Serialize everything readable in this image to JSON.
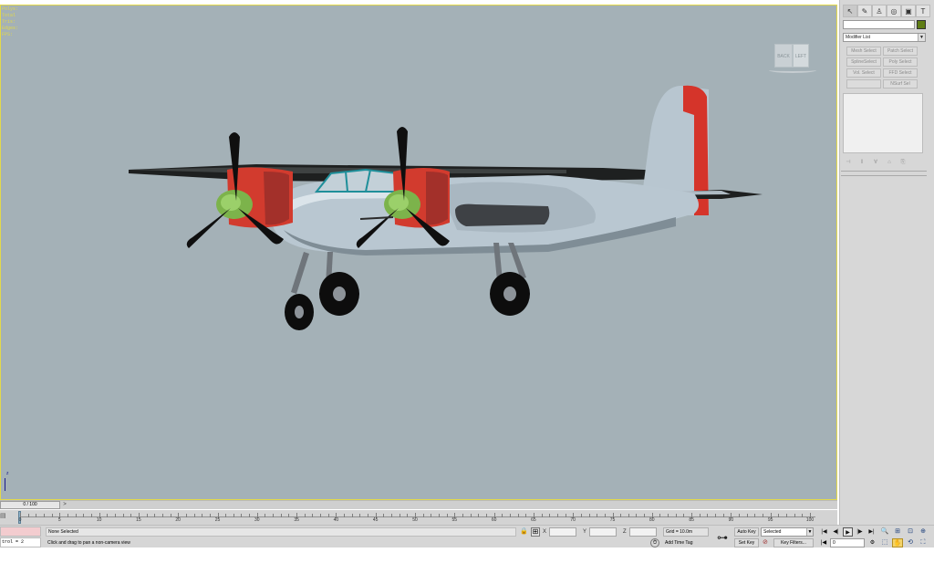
{
  "viewport": {
    "stats": [
      "Polys:",
      "Total    ",
      "Tris:  ",
      "Edges:",
      "",
      "FPS:   "
    ],
    "viewcube": {
      "left_face": "BACK",
      "right_face": "LEFT"
    },
    "axis_label": "z",
    "colors": {
      "background": "#a4b1b7",
      "border": "#e3d94a"
    }
  },
  "command_panel": {
    "tabs": [
      {
        "name": "pointer-icon",
        "glyph": "↖"
      },
      {
        "name": "create-icon",
        "glyph": "✎"
      },
      {
        "name": "hierarchy-icon",
        "glyph": "♙"
      },
      {
        "name": "motion-icon",
        "glyph": "◎"
      },
      {
        "name": "display-icon",
        "glyph": "▣"
      },
      {
        "name": "utilities-icon",
        "glyph": "T"
      }
    ],
    "swatch_color": "#5f7d14",
    "modifier_list": "Modifier List",
    "modifier_buttons": [
      "Mesh Select",
      "Patch Select",
      "SplineSelect",
      "Poly Select",
      "Vol. Select",
      "FFD Select",
      "",
      "NSurf Sel"
    ],
    "stack_tools": [
      "⊣",
      "‖",
      "∀",
      "⌂",
      "⎘"
    ]
  },
  "timeline": {
    "slider_label": "0 / 100",
    "next_arrow": ">",
    "tick_labels": [
      "0",
      "5",
      "10",
      "15",
      "20",
      "25",
      "30",
      "35",
      "40",
      "45",
      "50",
      "55",
      "60",
      "65",
      "70",
      "75",
      "80",
      "85",
      "90",
      "95",
      "100"
    ],
    "current_frame": 0,
    "total_frames": 100
  },
  "status": {
    "listener_text": "trol   = 2",
    "selection_text": "None Selected",
    "prompt_text": "Click and drag to pan a non-camera view",
    "coord_x_label": "X",
    "coord_y_label": "Y",
    "coord_z_label": "Z",
    "grid_text": "Grid = 10.0m",
    "add_time_tag": "Add Time Tag",
    "auto_key": "Auto Key",
    "set_key": "Set Key",
    "selected_dropdown": "Selected",
    "key_filters": "Key Filters...",
    "frame_value": "0",
    "playback": [
      "|◀",
      "◀|",
      "▶",
      "|▶",
      "▶|"
    ]
  },
  "navigation": [
    "🔍",
    "⊞",
    "⊡",
    "⊕",
    "⬚",
    "✋",
    "⟲",
    "⛶"
  ]
}
